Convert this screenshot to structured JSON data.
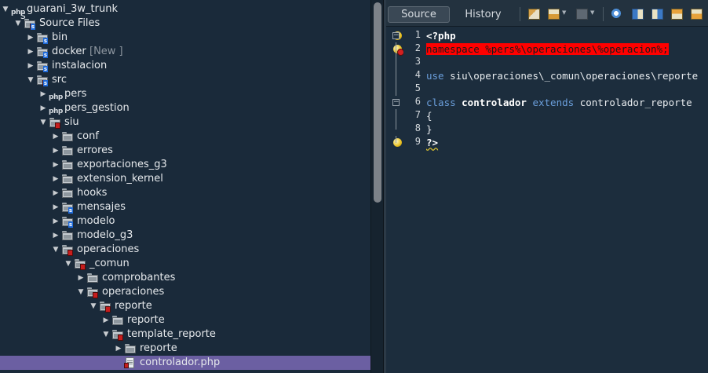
{
  "tree": {
    "items": [
      {
        "label": "guarani_3w_trunk",
        "depth": 0,
        "toggle": "down",
        "icon": "php-project-icon",
        "tag": ""
      },
      {
        "label": "Source Files",
        "depth": 1,
        "toggle": "down",
        "icon": "source-files-icon",
        "tag": ""
      },
      {
        "label": "bin",
        "depth": 2,
        "toggle": "right",
        "icon": "folder-icon",
        "tag": ""
      },
      {
        "label": "docker",
        "depth": 2,
        "toggle": "right",
        "icon": "folder-icon",
        "tag": "[New ]"
      },
      {
        "label": "instalacion",
        "depth": 2,
        "toggle": "right",
        "icon": "folder-icon",
        "tag": ""
      },
      {
        "label": "src",
        "depth": 2,
        "toggle": "down",
        "icon": "folder-error-icon",
        "tag": ""
      },
      {
        "label": "pers",
        "depth": 3,
        "toggle": "right",
        "icon": "php-icon",
        "tag": ""
      },
      {
        "label": "pers_gestion",
        "depth": 3,
        "toggle": "right",
        "icon": "php-icon",
        "tag": ""
      },
      {
        "label": "siu",
        "depth": 3,
        "toggle": "down",
        "icon": "folder-error-icon",
        "tag": ""
      },
      {
        "label": "conf",
        "depth": 4,
        "toggle": "right",
        "icon": "folder-icon",
        "tag": ""
      },
      {
        "label": "errores",
        "depth": 4,
        "toggle": "right",
        "icon": "folder-icon",
        "tag": ""
      },
      {
        "label": "exportaciones_g3",
        "depth": 4,
        "toggle": "right",
        "icon": "folder-icon",
        "tag": ""
      },
      {
        "label": "extension_kernel",
        "depth": 4,
        "toggle": "right",
        "icon": "folder-icon",
        "tag": ""
      },
      {
        "label": "hooks",
        "depth": 4,
        "toggle": "right",
        "icon": "folder-icon",
        "tag": ""
      },
      {
        "label": "mensajes",
        "depth": 4,
        "toggle": "right",
        "icon": "folder-source-icon",
        "tag": ""
      },
      {
        "label": "modelo",
        "depth": 4,
        "toggle": "right",
        "icon": "folder-source-icon",
        "tag": ""
      },
      {
        "label": "modelo_g3",
        "depth": 4,
        "toggle": "right",
        "icon": "folder-icon",
        "tag": ""
      },
      {
        "label": "operaciones",
        "depth": 4,
        "toggle": "down",
        "icon": "folder-error-icon",
        "tag": ""
      },
      {
        "label": "_comun",
        "depth": 5,
        "toggle": "down",
        "icon": "folder-error-icon",
        "tag": ""
      },
      {
        "label": "comprobantes",
        "depth": 6,
        "toggle": "right",
        "icon": "folder-icon",
        "tag": ""
      },
      {
        "label": "operaciones",
        "depth": 6,
        "toggle": "down",
        "icon": "folder-error-icon",
        "tag": ""
      },
      {
        "label": "reporte",
        "depth": 7,
        "toggle": "down",
        "icon": "folder-error-icon",
        "tag": ""
      },
      {
        "label": "reporte",
        "depth": 8,
        "toggle": "right",
        "icon": "folder-icon",
        "tag": ""
      },
      {
        "label": "template_reporte",
        "depth": 8,
        "toggle": "down",
        "icon": "folder-error-icon",
        "tag": ""
      },
      {
        "label": "reporte",
        "depth": 9,
        "toggle": "right",
        "icon": "folder-icon",
        "tag": ""
      },
      {
        "label": "controlador.php",
        "depth": 9,
        "toggle": "",
        "icon": "php-file-error-icon",
        "tag": "",
        "selected": true
      }
    ]
  },
  "editor": {
    "tabs": {
      "source_label": "Source",
      "history_label": "History"
    },
    "lines": [
      {
        "num": "1",
        "gutter": "hint",
        "fold": "open",
        "segments": [
          {
            "t": "<?php",
            "c": "bold"
          }
        ]
      },
      {
        "num": "2",
        "gutter": "hint-error",
        "fold": "line",
        "segments": [
          {
            "t": "namespace %pers%\\operaciones\\%operacion%;",
            "c": "hl"
          }
        ]
      },
      {
        "num": "3",
        "gutter": "",
        "fold": "line",
        "segments": []
      },
      {
        "num": "4",
        "gutter": "",
        "fold": "line",
        "segments": [
          {
            "t": "use ",
            "c": "kw"
          },
          {
            "t": "siu\\operaciones\\_comun\\operaciones\\reporte",
            "c": ""
          }
        ]
      },
      {
        "num": "5",
        "gutter": "",
        "fold": "line",
        "segments": []
      },
      {
        "num": "6",
        "gutter": "",
        "fold": "open",
        "segments": [
          {
            "t": "class ",
            "c": "kw"
          },
          {
            "t": "controlador",
            "c": "bold"
          },
          {
            "t": " extends ",
            "c": "kw"
          },
          {
            "t": "controlador_reporte",
            "c": ""
          }
        ]
      },
      {
        "num": "7",
        "gutter": "",
        "fold": "line",
        "segments": [
          {
            "t": "{",
            "c": ""
          }
        ]
      },
      {
        "num": "8",
        "gutter": "",
        "fold": "end",
        "segments": [
          {
            "t": "}",
            "c": ""
          }
        ]
      },
      {
        "num": "9",
        "gutter": "hint",
        "fold": "end",
        "segments": [
          {
            "t": "?>",
            "c": "bold squig"
          }
        ]
      }
    ]
  },
  "colors": {
    "selection": "#6b5fa2",
    "error_highlight": "#ff0000",
    "keyword": "#6b9fdc",
    "background": "#1c2d3d"
  }
}
